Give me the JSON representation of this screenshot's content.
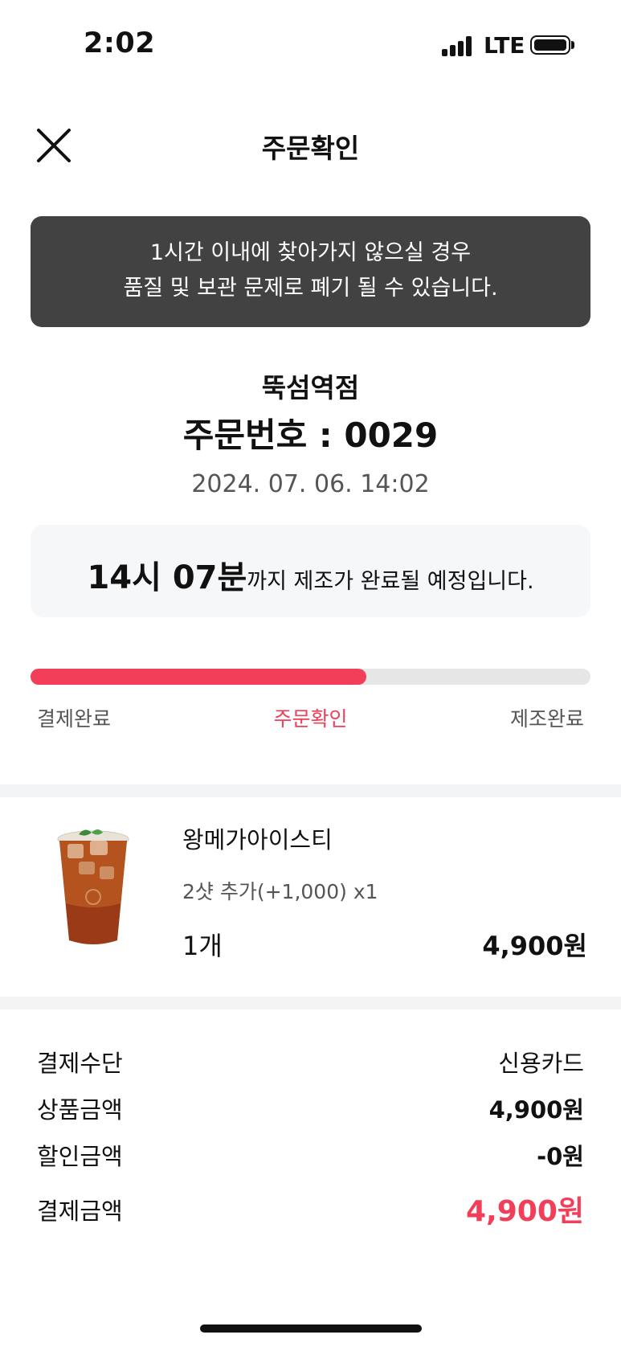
{
  "status_bar": {
    "time": "2:02",
    "network": "LTE"
  },
  "header": {
    "title": "주문확인",
    "close_icon": "close-icon"
  },
  "notice": {
    "line1": "1시간 이내에 찾아가지 않으실 경우",
    "line2": "품질 및 보관 문제로 폐기 될 수 있습니다."
  },
  "order": {
    "store": "뚝섬역점",
    "number_label": "주문번호 : 0029",
    "datetime": "2024. 07. 06. 14:02"
  },
  "eta": {
    "time": "14시 07분",
    "text": "까지 제조가 완료될 예정입니다."
  },
  "progress": {
    "fraction": 0.6,
    "steps": [
      "결제완료",
      "주문확인",
      "제조완료"
    ],
    "active_step": 1,
    "active_color": "#f23e58"
  },
  "item": {
    "name": "왕메가아이스티",
    "option": "2샷 추가(+1,000) x1",
    "quantity": "1개",
    "price": "4,900원",
    "image_icon": "iced-tea-cup-icon"
  },
  "summary": [
    {
      "label": "결제수단",
      "value": "신용카드"
    },
    {
      "label": "상품금액",
      "value": "4,900원"
    },
    {
      "label": "할인금액",
      "value": "-0원"
    },
    {
      "label": "결제금액",
      "value": "4,900원"
    }
  ],
  "colors": {
    "accent": "#f23e58",
    "notice_bg": "#424242",
    "eta_bg": "#f6f7f9"
  }
}
